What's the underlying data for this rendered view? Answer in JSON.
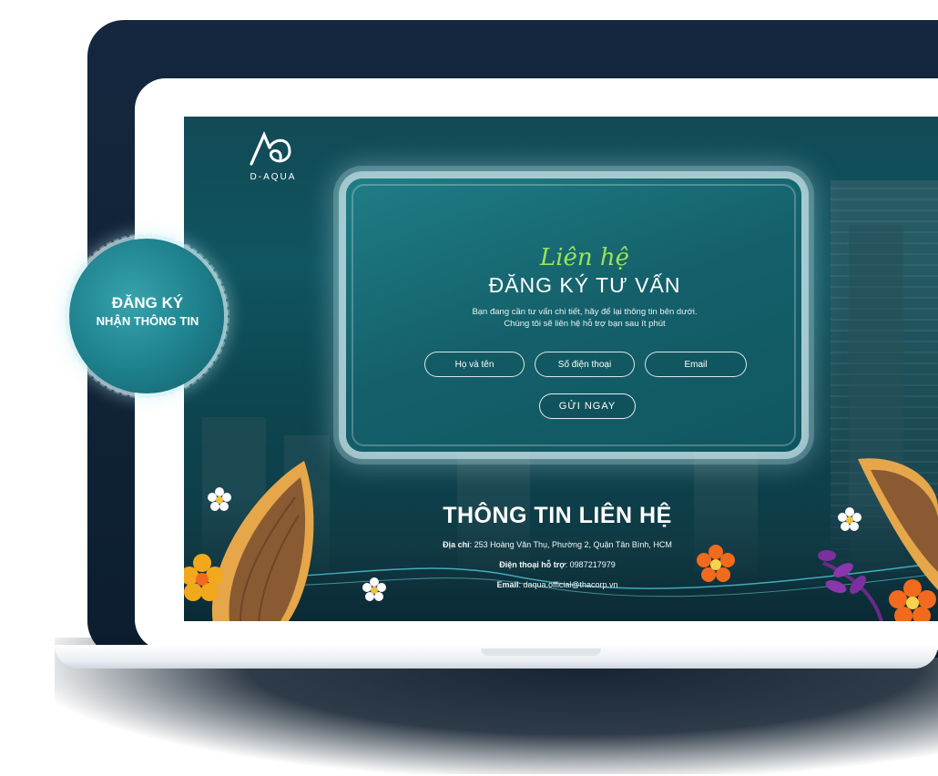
{
  "brand": {
    "logo_mark": "A○",
    "logo_text": "D-AQUA"
  },
  "badge": {
    "line1": "ĐĂNG KÝ",
    "line2": "NHẬN THÔNG TIN"
  },
  "form": {
    "script_title": "Liên hệ",
    "title": "ĐĂNG KÝ TƯ VẤN",
    "description_line1": "Bạn đang cần tư vấn chi tiết, hãy để lại thông tin bên dưới.",
    "description_line2": "Chúng tôi sẽ liên hệ hỗ trợ bạn sau ít phút",
    "fields": [
      {
        "placeholder": "Họ và tên"
      },
      {
        "placeholder": "Số điện thoại"
      },
      {
        "placeholder": "Email"
      }
    ],
    "submit_label": "GỬI NGAY"
  },
  "contact": {
    "title": "THÔNG TIN LIÊN HỆ",
    "address_label": "Địa chỉ",
    "address_value": ": 253 Hoàng Văn Thụ, Phường 2, Quận Tân Bình, HCM",
    "phone_label": "Điện thoại hỗ trợ",
    "phone_value": ": 0987217979",
    "email_label": "Email",
    "email_value": ": daqua.official@thacorp.vn"
  },
  "colors": {
    "accent_green": "#9be35a",
    "screen_bg": "#0f5560",
    "laptop_back": "#14273e"
  },
  "icons": [
    "daqua-logo-icon",
    "boat-icon",
    "flower-icon"
  ]
}
